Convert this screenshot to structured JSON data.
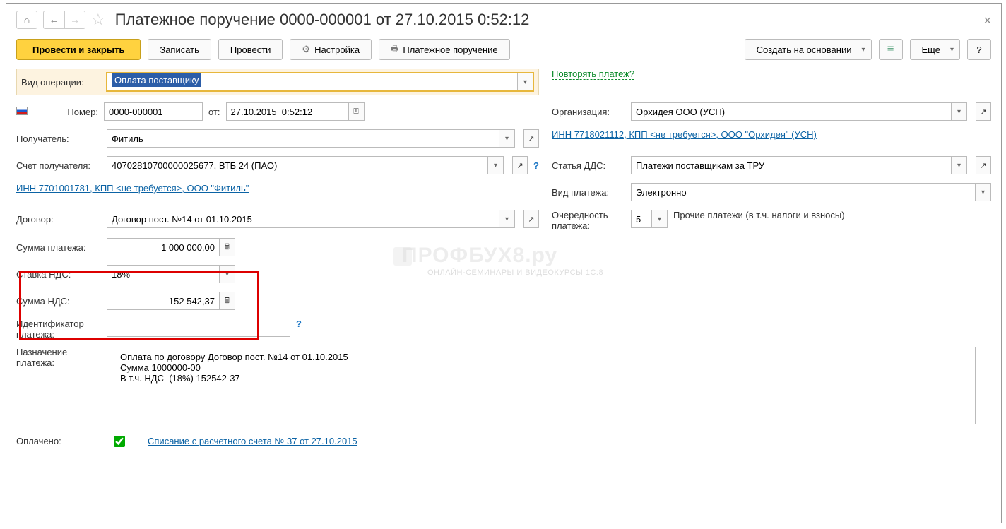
{
  "header": {
    "title": "Платежное поручение 0000-000001 от 27.10.2015 0:52:12"
  },
  "toolbar": {
    "post_close": "Провести и закрыть",
    "save": "Записать",
    "post": "Провести",
    "settings": "Настройка",
    "print": "Платежное поручение",
    "create_based": "Создать на основании",
    "more": "Еще"
  },
  "fields": {
    "op_label": "Вид операции:",
    "op_value": "Оплата поставщику",
    "repeat_link": "Повторять платеж?",
    "num_label": "Номер:",
    "num_value": "0000-000001",
    "date_from": "от:",
    "date_value": "27.10.2015  0:52:12",
    "org_label": "Организация:",
    "org_value": "Орхидея ООО (УСН)",
    "recip_label": "Получатель:",
    "recip_value": "Фитиль",
    "recip_link": "ИНН 7718021112, КПП <не требуется>, ООО \"Орхидея\" (УСН)",
    "acct_label": "Счет получателя:",
    "acct_value": "40702810700000025677, ВТБ 24 (ПАО)",
    "dds_label": "Статья ДДС:",
    "dds_value": "Платежи поставщикам за ТРУ",
    "bank_link": "ИНН 7701001781, КПП <не требуется>, ООО \"Фитиль\"",
    "paytype_label": "Вид платежа:",
    "paytype_value": "Электронно",
    "contract_label": "Договор:",
    "contract_value": "Договор пост. №14 от 01.10.2015",
    "priority_label": "Очередность платежа:",
    "priority_value": "5",
    "priority_note": "Прочие платежи (в т.ч. налоги и взносы)",
    "amount_label": "Сумма платежа:",
    "amount_value": "1 000 000,00",
    "vat_rate_label": "Ставка НДС:",
    "vat_rate_value": "18%",
    "vat_sum_label": "Сумма НДС:",
    "vat_sum_value": "152 542,37",
    "id_label": "Идентификатор платежа:",
    "purpose_label": "Назначение платежа:",
    "purpose_value": "Оплата по договору Договор пост. №14 от 01.10.2015\nСумма 1000000-00\nВ т.ч. НДС  (18%) 152542-37",
    "paid_label": "Оплачено:",
    "paid_link": "Списание с расчетного счета № 37 от 27.10.2015"
  },
  "watermark": {
    "main": "ПРОФБУХ8.ру",
    "sub": "ОНЛАЙН-СЕМИНАРЫ И ВИДЕОКУРСЫ 1С:8"
  }
}
